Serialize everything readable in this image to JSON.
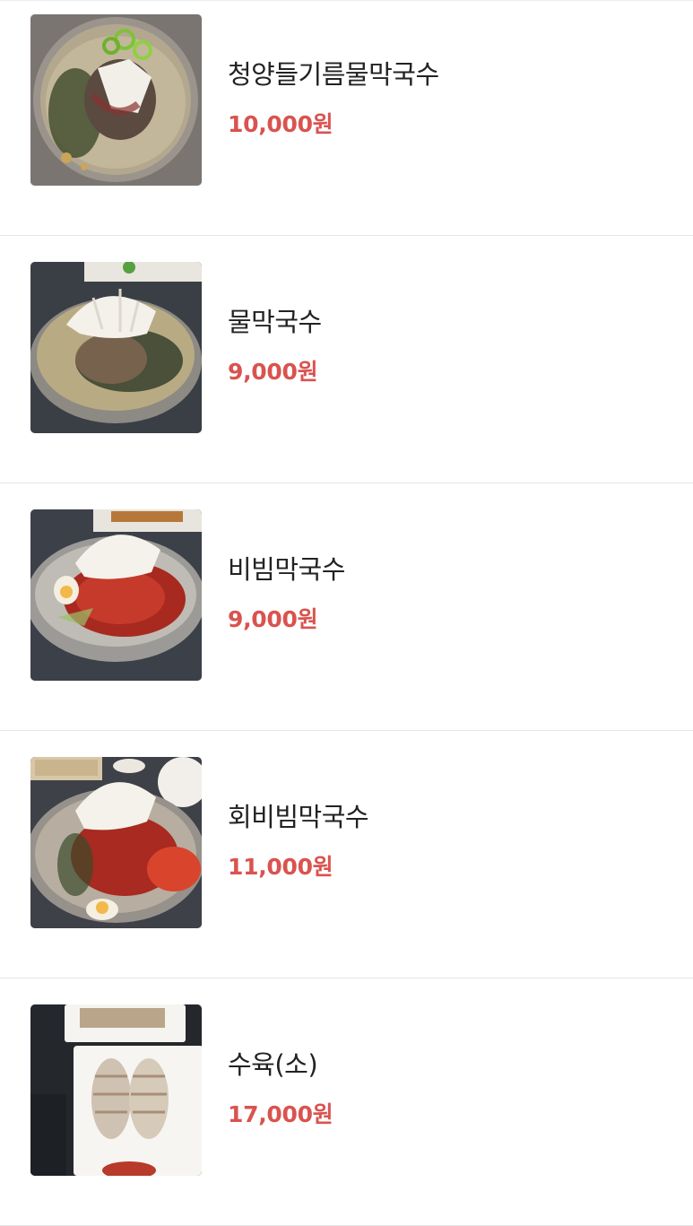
{
  "menu": {
    "items": [
      {
        "name": "청양들기름물막국수",
        "price": "10,000원",
        "image": "cold-buckwheat-noodles-chili-perilla-oil"
      },
      {
        "name": "물막국수",
        "price": "9,000원",
        "image": "cold-buckwheat-noodles-in-broth"
      },
      {
        "name": "비빔막국수",
        "price": "9,000원",
        "image": "spicy-mixed-buckwheat-noodles"
      },
      {
        "name": "회비빔막국수",
        "price": "11,000원",
        "image": "spicy-buckwheat-noodles-with-raw-fish"
      },
      {
        "name": "수육(소)",
        "price": "17,000원",
        "image": "boiled-pork-slices-small"
      }
    ]
  },
  "colors": {
    "price": "#d9534f",
    "name": "#222222",
    "divider": "#e6e6e6"
  }
}
